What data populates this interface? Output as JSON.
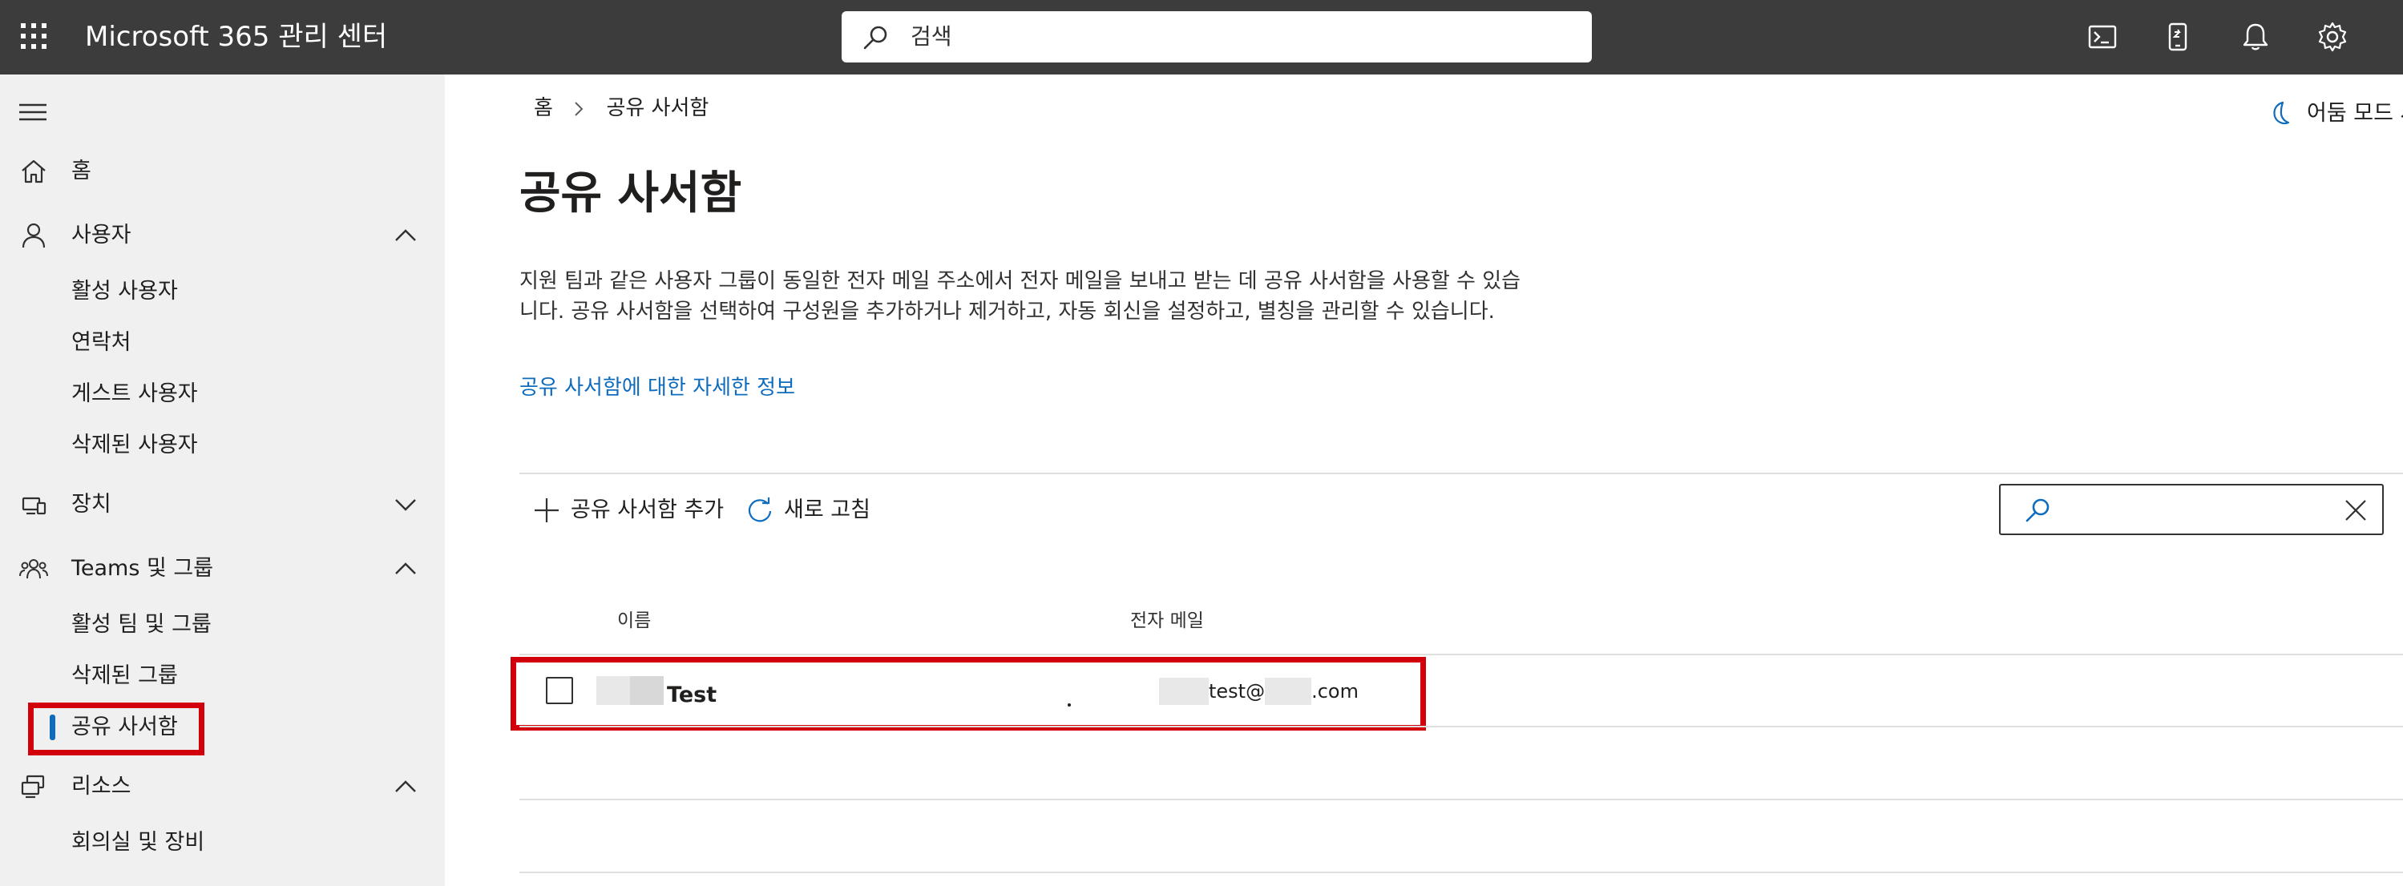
{
  "header": {
    "app_title": "Microsoft 365 관리 센터",
    "search_placeholder": "검색",
    "icons": [
      "waffle-icon",
      "terminal-icon",
      "mobile-icon",
      "bell-icon",
      "gear-icon"
    ]
  },
  "sidebar": {
    "items": [
      {
        "label": "홈",
        "icon": "home-icon"
      },
      {
        "label": "사용자",
        "icon": "person-icon",
        "expanded": true,
        "children": [
          "활성 사용자",
          "연락처",
          "게스트 사용자",
          "삭제된 사용자"
        ]
      },
      {
        "label": "장치",
        "icon": "device-icon",
        "expanded": false
      },
      {
        "label": "Teams 및 그룹",
        "icon": "people-icon",
        "expanded": true,
        "children": [
          "활성 팀 및 그룹",
          "삭제된 그룹",
          "공유 사서함"
        ]
      },
      {
        "label": "리소스",
        "icon": "resources-icon",
        "expanded": true,
        "children": [
          "회의실 및 장비"
        ]
      }
    ],
    "active_item": "공유 사서함"
  },
  "breadcrumb": {
    "home": "홈",
    "current": "공유 사서함"
  },
  "dark_mode_label": "어둠 모드 사",
  "page": {
    "title": "공유 사서함",
    "description": "지원 팀과 같은 사용자 그룹이 동일한 전자 메일 주소에서 전자 메일을 보내고 받는 데 공유 사서함을 사용할 수 있습니다. 공유 사서함을 선택하여 구성원을 추가하거나 제거하고, 자동 회신을 설정하고, 별칭을 관리할 수 있습니다.",
    "learn_more": "공유 사서함에 대한 자세한 정보"
  },
  "commands": {
    "add": "공유 사서함 추가",
    "refresh": "새로 고침"
  },
  "table": {
    "columns": [
      "이름",
      "전자 메일"
    ],
    "rows": [
      {
        "name": "Test",
        "email_local": "test@",
        "email_tld": ".com"
      }
    ]
  },
  "colors": {
    "topbar": "#3c3c3c",
    "sidebar": "#f0f0f0",
    "accent": "#0f6cbd",
    "highlight": "#d1000b"
  }
}
